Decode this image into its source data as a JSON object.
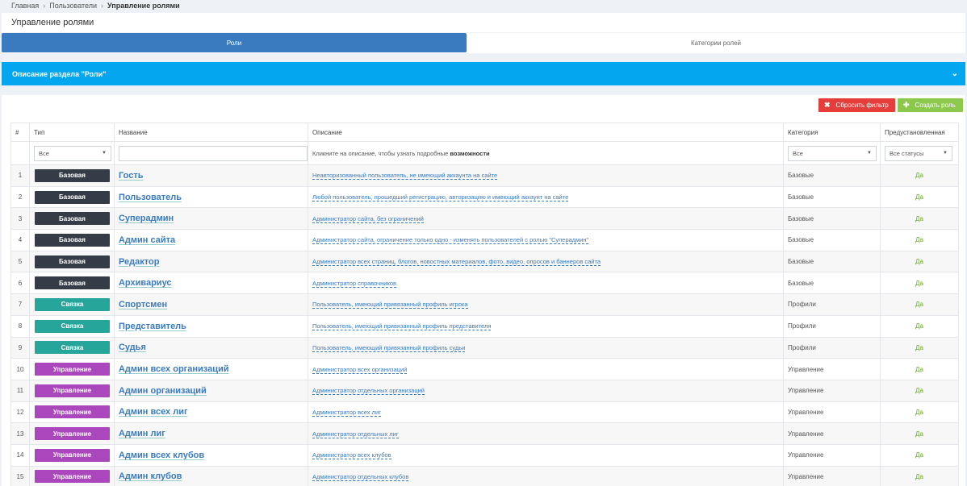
{
  "breadcrumb": {
    "home": "Главная",
    "users": "Пользователи",
    "current": "Управление ролями"
  },
  "page_title": "Управление ролями",
  "tabs": {
    "roles": "Роли",
    "categories": "Категории ролей"
  },
  "info_panel": {
    "title": "Описание раздела \"Роли\""
  },
  "buttons": {
    "reset": "Сбросить фильтр",
    "create": "Создать роль"
  },
  "table": {
    "headers": {
      "num": "#",
      "type": "Тип",
      "name": "Название",
      "desc": "Описание",
      "category": "Категория",
      "preset": "Предустановленная"
    },
    "filters": {
      "type": "Все",
      "desc_hint": "Кликните на описание, чтобы узнать подробные ",
      "desc_hint_bold": "возможности",
      "category": "Все",
      "preset": "Все статусы"
    },
    "rows": [
      {
        "num": "1",
        "type": "Базовая",
        "name": "Гость",
        "desc": "Неавторизованный пользователь, не имеющий аккаунта на сайте",
        "category": "Базовые",
        "preset": "Да"
      },
      {
        "num": "2",
        "type": "Базовая",
        "name": "Пользователь",
        "desc": "Любой пользователь, прошедший регистрацию, авторизацию и имеющий аккаунт на сайте",
        "category": "Базовые",
        "preset": "Да"
      },
      {
        "num": "3",
        "type": "Базовая",
        "name": "Суперадмин",
        "desc": "Администратор сайта, без ограничений",
        "category": "Базовые",
        "preset": "Да"
      },
      {
        "num": "4",
        "type": "Базовая",
        "name": "Админ сайта",
        "desc": "Администратор сайта, ограничение только одно - изменять пользователей с ролью \"Суперадмин\"",
        "category": "Базовые",
        "preset": "Да"
      },
      {
        "num": "5",
        "type": "Базовая",
        "name": "Редактор",
        "desc": "Администратор всех страниц, блогов, новостных материалов, фото, видео, опросов и баннеров сайта",
        "category": "Базовые",
        "preset": "Да"
      },
      {
        "num": "6",
        "type": "Базовая",
        "name": "Архивариус",
        "desc": "Администратор справочников",
        "category": "Базовые",
        "preset": "Да"
      },
      {
        "num": "7",
        "type": "Связка",
        "name": "Спортсмен",
        "desc": "Пользователь, имеющий привязанный профиль игрока",
        "category": "Профили",
        "preset": "Да"
      },
      {
        "num": "8",
        "type": "Связка",
        "name": "Представитель",
        "desc": "Пользователь, имеющий привязанный профиль представителя",
        "category": "Профили",
        "preset": "Да"
      },
      {
        "num": "9",
        "type": "Связка",
        "name": "Судья",
        "desc": "Пользователь, имеющий привязанный профиль судьи",
        "category": "Профили",
        "preset": "Да"
      },
      {
        "num": "10",
        "type": "Управление",
        "name": "Админ всех организаций",
        "desc": "Администратор всех организаций",
        "category": "Управление",
        "preset": "Да"
      },
      {
        "num": "11",
        "type": "Управление",
        "name": "Админ организаций",
        "desc": "Администратор отдельных организаций",
        "category": "Управление",
        "preset": "Да"
      },
      {
        "num": "12",
        "type": "Управление",
        "name": "Админ всех лиг",
        "desc": "Администратор всех лиг",
        "category": "Управление",
        "preset": "Да"
      },
      {
        "num": "13",
        "type": "Управление",
        "name": "Админ лиг",
        "desc": "Администратор отдельных лиг",
        "category": "Управление",
        "preset": "Да"
      },
      {
        "num": "14",
        "type": "Управление",
        "name": "Админ всех клубов",
        "desc": "Администратор всех клубов",
        "category": "Управление",
        "preset": "Да"
      },
      {
        "num": "15",
        "type": "Управление",
        "name": "Админ клубов",
        "desc": "Администратор отдельных клубов",
        "category": "Управление",
        "preset": "Да"
      }
    ]
  },
  "badge_colors": {
    "Базовая": "#353c48",
    "Связка": "#26a69a",
    "Управление": "#ab47bc"
  }
}
